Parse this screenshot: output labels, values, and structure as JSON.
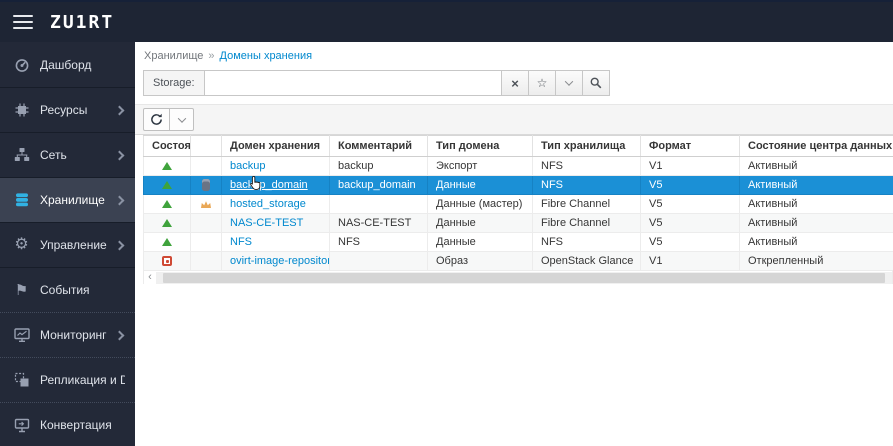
{
  "topbar": {
    "logo": "ZU1RT"
  },
  "breadcrumb": {
    "parent": "Хранилище",
    "separator": "»",
    "current": "Домены хранения"
  },
  "search": {
    "label": "Storage:",
    "value": "",
    "placeholder": "",
    "buttons": {
      "clear": "×",
      "favorite": "☆",
      "dropdown": "v",
      "search": "magnifier"
    }
  },
  "sidebar": {
    "items": [
      {
        "label": "Дашборд",
        "icon": "dashboard-icon",
        "expandable": false,
        "active": false
      },
      {
        "label": "Ресурсы",
        "icon": "resources-icon",
        "expandable": true,
        "active": false
      },
      {
        "label": "Сеть",
        "icon": "network-icon",
        "expandable": true,
        "active": false
      },
      {
        "label": "Хранилище",
        "icon": "storage-icon",
        "expandable": true,
        "active": true
      },
      {
        "label": "Управление",
        "icon": "management-icon",
        "expandable": true,
        "active": false
      },
      {
        "label": "События",
        "icon": "events-icon",
        "expandable": false,
        "active": false
      },
      {
        "label": "Мониторинг",
        "icon": "monitoring-icon",
        "expandable": true,
        "active": false
      },
      {
        "label": "Репликация и DR",
        "icon": "replication-icon",
        "expandable": false,
        "active": false
      },
      {
        "label": "Конвертация",
        "icon": "conversion-icon",
        "expandable": false,
        "active": false
      }
    ]
  },
  "toolbar": {
    "refresh_icon": "refresh-icon",
    "caret_icon": "chevron-down-icon"
  },
  "table": {
    "columns": [
      "Состоя",
      "",
      "Домен хранения",
      "Комментарий",
      "Тип домена",
      "Тип хранилища",
      "Формат",
      "Состояние центра данных"
    ],
    "scroll_left_arrow": "‹",
    "rows": [
      {
        "status": "up",
        "flag": "",
        "name": "backup",
        "comment": "backup",
        "domain_type": "Экспорт",
        "storage_type": "NFS",
        "format": "V1",
        "dc_status": "Активный",
        "selected": false
      },
      {
        "status": "up",
        "flag": "backup",
        "name": "backup_domain",
        "comment": "backup_domain",
        "domain_type": "Данные",
        "storage_type": "NFS",
        "format": "V5",
        "dc_status": "Активный",
        "selected": true
      },
      {
        "status": "up",
        "flag": "master",
        "name": "hosted_storage",
        "comment": "",
        "domain_type": "Данные (мастер)",
        "storage_type": "Fibre Channel",
        "format": "V5",
        "dc_status": "Активный",
        "selected": false
      },
      {
        "status": "up",
        "flag": "",
        "name": "NAS-CE-TEST",
        "comment": "NAS-CE-TEST",
        "domain_type": "Данные",
        "storage_type": "Fibre Channel",
        "format": "V5",
        "dc_status": "Активный",
        "selected": false
      },
      {
        "status": "up",
        "flag": "",
        "name": "NFS",
        "comment": "NFS",
        "domain_type": "Данные",
        "storage_type": "NFS",
        "format": "V5",
        "dc_status": "Активный",
        "selected": false
      },
      {
        "status": "detached",
        "flag": "",
        "name": "ovirt-image-repository",
        "comment": "",
        "domain_type": "Образ",
        "storage_type": "OpenStack Glance",
        "format": "V1",
        "dc_status": "Открепленный",
        "selected": false
      }
    ]
  },
  "colors": {
    "topbar_bg": "#1e2534",
    "sidebar_bg": "#232938",
    "sidebar_active_bg": "#3b4252",
    "accent_link": "#0088ce",
    "selected_row": "#1b90d6",
    "status_up": "#3fa33c",
    "status_detached": "#cf4a35",
    "master_crown": "#e9a857",
    "sidebar_active_icon": "#31b2e3"
  }
}
